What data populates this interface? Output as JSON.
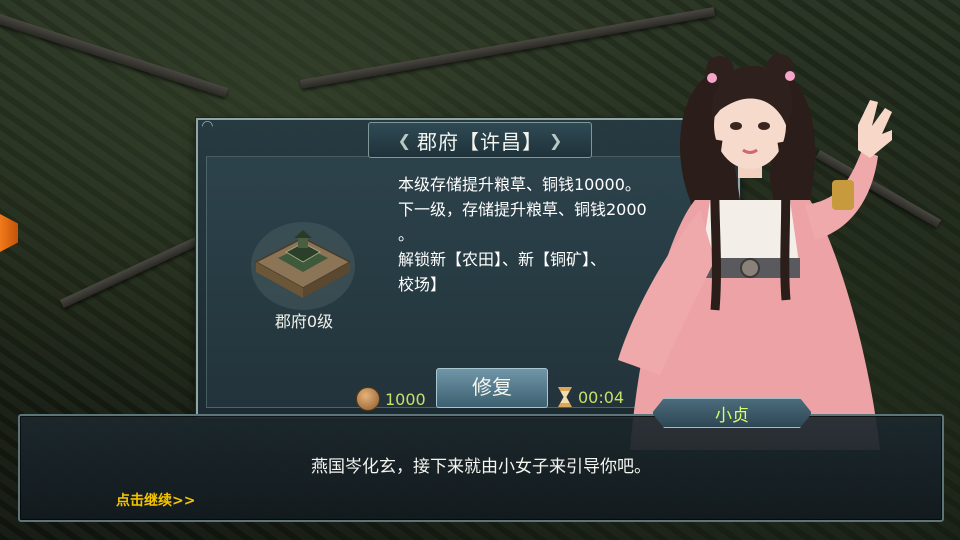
{
  "panel": {
    "title": "郡府【许昌】",
    "building_label": "郡府0级",
    "description_lines": [
      "本级存储提升粮草、铜钱10000。",
      "下一级，存储提升粮草、铜钱2000",
      "。",
      "解锁新【农田】、新【铜矿】、",
      "校场】"
    ],
    "cost": "1000",
    "repair_label": "修复",
    "timer": "00:04"
  },
  "dialog": {
    "speaker": "小贞",
    "text": "燕国岑化玄，接下来就由小女子来引导你吧。",
    "continue_label": "点击继续>>"
  },
  "icons": {
    "cost": "coin-icon",
    "timer": "hourglass-icon"
  },
  "colors": {
    "accent_green": "#c7e06a",
    "continue_yellow": "#f5c400",
    "name_green": "#d7ff6a"
  }
}
